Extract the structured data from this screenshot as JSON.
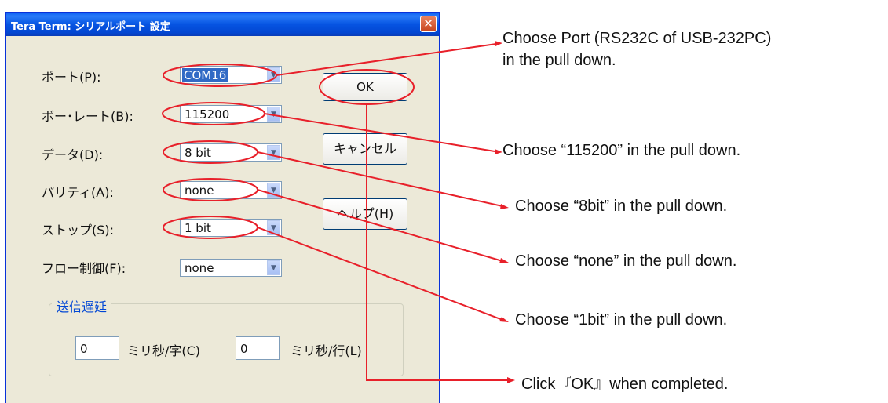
{
  "dialog": {
    "title": "Tera Term: シリアルポート 設定",
    "close_glyph": "✕",
    "fields": [
      {
        "label": "ポート(P):",
        "value": "COM16"
      },
      {
        "label": "ボー･レート(B):",
        "value": "115200"
      },
      {
        "label": "データ(D):",
        "value": "8 bit"
      },
      {
        "label": "パリティ(A):",
        "value": "none"
      },
      {
        "label": "ストップ(S):",
        "value": "1 bit"
      },
      {
        "label": "フロー制御(F):",
        "value": "none"
      }
    ],
    "ok_label": "OK",
    "cancel_label": "キャンセル",
    "help_label": "ヘルプ(H)",
    "delay": {
      "title": "送信遅延",
      "char_value": "0",
      "char_label": "ミリ秒/字(C)",
      "line_value": "0",
      "line_label": "ミリ秒/行(L)"
    }
  },
  "annotations": [
    "Choose Port (RS232C of USB-232PC)",
    "in the pull down.",
    "Choose “115200” in the pull down.",
    "Choose “8bit” in the pull down.",
    "Choose “none” in the pull down.",
    "Choose “1bit” in the pull down.",
    "Click『OK』when completed."
  ],
  "colors": {
    "annotation_red": "#e8202a",
    "title_bar": "#0a5ef4"
  },
  "icons": {
    "dropdown": "chevron-down-icon",
    "close": "close-icon"
  }
}
